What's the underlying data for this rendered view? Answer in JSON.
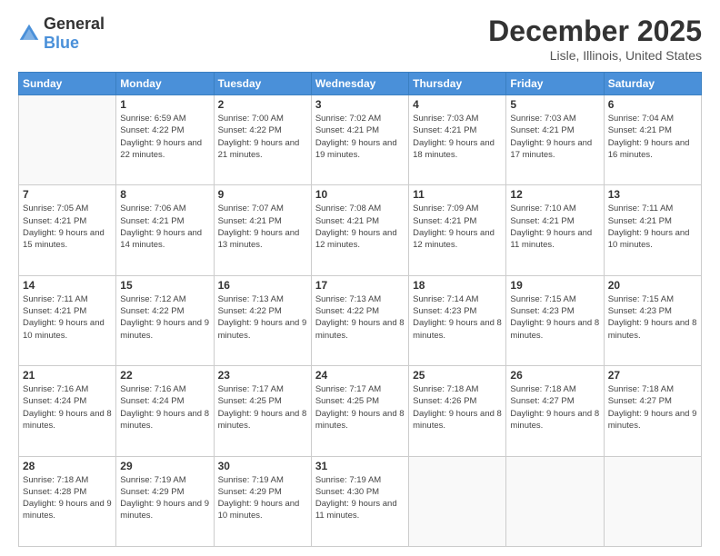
{
  "logo": {
    "general": "General",
    "blue": "Blue"
  },
  "header": {
    "title": "December 2025",
    "subtitle": "Lisle, Illinois, United States"
  },
  "weekdays": [
    "Sunday",
    "Monday",
    "Tuesday",
    "Wednesday",
    "Thursday",
    "Friday",
    "Saturday"
  ],
  "weeks": [
    [
      {
        "day": "",
        "empty": true
      },
      {
        "day": "1",
        "sunrise": "Sunrise: 6:59 AM",
        "sunset": "Sunset: 4:22 PM",
        "daylight": "Daylight: 9 hours and 22 minutes."
      },
      {
        "day": "2",
        "sunrise": "Sunrise: 7:00 AM",
        "sunset": "Sunset: 4:22 PM",
        "daylight": "Daylight: 9 hours and 21 minutes."
      },
      {
        "day": "3",
        "sunrise": "Sunrise: 7:02 AM",
        "sunset": "Sunset: 4:21 PM",
        "daylight": "Daylight: 9 hours and 19 minutes."
      },
      {
        "day": "4",
        "sunrise": "Sunrise: 7:03 AM",
        "sunset": "Sunset: 4:21 PM",
        "daylight": "Daylight: 9 hours and 18 minutes."
      },
      {
        "day": "5",
        "sunrise": "Sunrise: 7:03 AM",
        "sunset": "Sunset: 4:21 PM",
        "daylight": "Daylight: 9 hours and 17 minutes."
      },
      {
        "day": "6",
        "sunrise": "Sunrise: 7:04 AM",
        "sunset": "Sunset: 4:21 PM",
        "daylight": "Daylight: 9 hours and 16 minutes."
      }
    ],
    [
      {
        "day": "7",
        "sunrise": "Sunrise: 7:05 AM",
        "sunset": "Sunset: 4:21 PM",
        "daylight": "Daylight: 9 hours and 15 minutes."
      },
      {
        "day": "8",
        "sunrise": "Sunrise: 7:06 AM",
        "sunset": "Sunset: 4:21 PM",
        "daylight": "Daylight: 9 hours and 14 minutes."
      },
      {
        "day": "9",
        "sunrise": "Sunrise: 7:07 AM",
        "sunset": "Sunset: 4:21 PM",
        "daylight": "Daylight: 9 hours and 13 minutes."
      },
      {
        "day": "10",
        "sunrise": "Sunrise: 7:08 AM",
        "sunset": "Sunset: 4:21 PM",
        "daylight": "Daylight: 9 hours and 12 minutes."
      },
      {
        "day": "11",
        "sunrise": "Sunrise: 7:09 AM",
        "sunset": "Sunset: 4:21 PM",
        "daylight": "Daylight: 9 hours and 12 minutes."
      },
      {
        "day": "12",
        "sunrise": "Sunrise: 7:10 AM",
        "sunset": "Sunset: 4:21 PM",
        "daylight": "Daylight: 9 hours and 11 minutes."
      },
      {
        "day": "13",
        "sunrise": "Sunrise: 7:11 AM",
        "sunset": "Sunset: 4:21 PM",
        "daylight": "Daylight: 9 hours and 10 minutes."
      }
    ],
    [
      {
        "day": "14",
        "sunrise": "Sunrise: 7:11 AM",
        "sunset": "Sunset: 4:21 PM",
        "daylight": "Daylight: 9 hours and 10 minutes."
      },
      {
        "day": "15",
        "sunrise": "Sunrise: 7:12 AM",
        "sunset": "Sunset: 4:22 PM",
        "daylight": "Daylight: 9 hours and 9 minutes."
      },
      {
        "day": "16",
        "sunrise": "Sunrise: 7:13 AM",
        "sunset": "Sunset: 4:22 PM",
        "daylight": "Daylight: 9 hours and 9 minutes."
      },
      {
        "day": "17",
        "sunrise": "Sunrise: 7:13 AM",
        "sunset": "Sunset: 4:22 PM",
        "daylight": "Daylight: 9 hours and 8 minutes."
      },
      {
        "day": "18",
        "sunrise": "Sunrise: 7:14 AM",
        "sunset": "Sunset: 4:23 PM",
        "daylight": "Daylight: 9 hours and 8 minutes."
      },
      {
        "day": "19",
        "sunrise": "Sunrise: 7:15 AM",
        "sunset": "Sunset: 4:23 PM",
        "daylight": "Daylight: 9 hours and 8 minutes."
      },
      {
        "day": "20",
        "sunrise": "Sunrise: 7:15 AM",
        "sunset": "Sunset: 4:23 PM",
        "daylight": "Daylight: 9 hours and 8 minutes."
      }
    ],
    [
      {
        "day": "21",
        "sunrise": "Sunrise: 7:16 AM",
        "sunset": "Sunset: 4:24 PM",
        "daylight": "Daylight: 9 hours and 8 minutes."
      },
      {
        "day": "22",
        "sunrise": "Sunrise: 7:16 AM",
        "sunset": "Sunset: 4:24 PM",
        "daylight": "Daylight: 9 hours and 8 minutes."
      },
      {
        "day": "23",
        "sunrise": "Sunrise: 7:17 AM",
        "sunset": "Sunset: 4:25 PM",
        "daylight": "Daylight: 9 hours and 8 minutes."
      },
      {
        "day": "24",
        "sunrise": "Sunrise: 7:17 AM",
        "sunset": "Sunset: 4:25 PM",
        "daylight": "Daylight: 9 hours and 8 minutes."
      },
      {
        "day": "25",
        "sunrise": "Sunrise: 7:18 AM",
        "sunset": "Sunset: 4:26 PM",
        "daylight": "Daylight: 9 hours and 8 minutes."
      },
      {
        "day": "26",
        "sunrise": "Sunrise: 7:18 AM",
        "sunset": "Sunset: 4:27 PM",
        "daylight": "Daylight: 9 hours and 8 minutes."
      },
      {
        "day": "27",
        "sunrise": "Sunrise: 7:18 AM",
        "sunset": "Sunset: 4:27 PM",
        "daylight": "Daylight: 9 hours and 9 minutes."
      }
    ],
    [
      {
        "day": "28",
        "sunrise": "Sunrise: 7:18 AM",
        "sunset": "Sunset: 4:28 PM",
        "daylight": "Daylight: 9 hours and 9 minutes."
      },
      {
        "day": "29",
        "sunrise": "Sunrise: 7:19 AM",
        "sunset": "Sunset: 4:29 PM",
        "daylight": "Daylight: 9 hours and 9 minutes."
      },
      {
        "day": "30",
        "sunrise": "Sunrise: 7:19 AM",
        "sunset": "Sunset: 4:29 PM",
        "daylight": "Daylight: 9 hours and 10 minutes."
      },
      {
        "day": "31",
        "sunrise": "Sunrise: 7:19 AM",
        "sunset": "Sunset: 4:30 PM",
        "daylight": "Daylight: 9 hours and 11 minutes."
      },
      {
        "day": "",
        "empty": true
      },
      {
        "day": "",
        "empty": true
      },
      {
        "day": "",
        "empty": true
      }
    ]
  ]
}
